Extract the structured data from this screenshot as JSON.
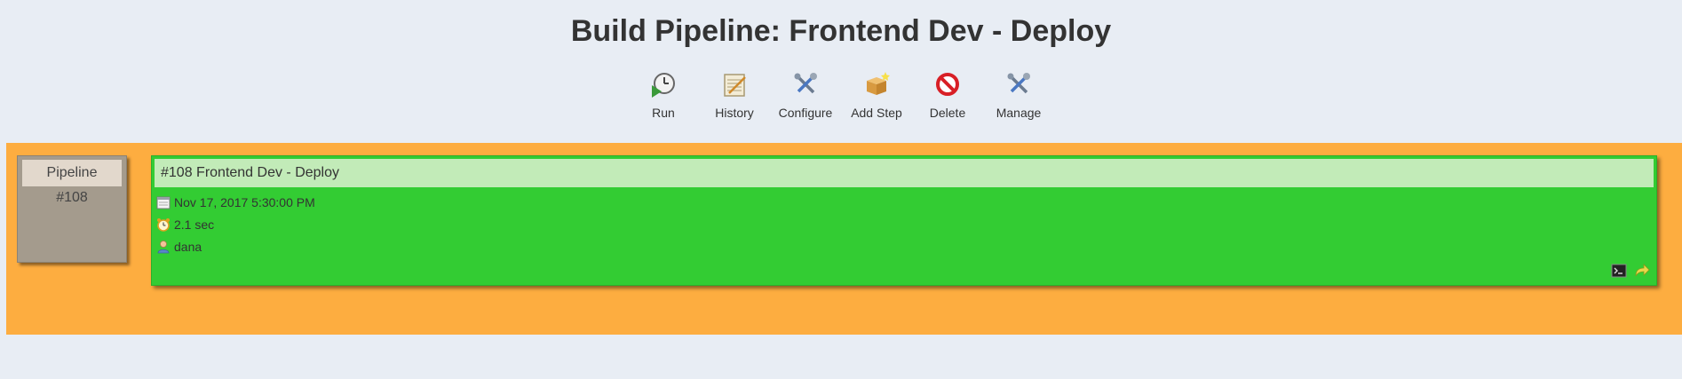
{
  "page": {
    "title": "Build Pipeline: Frontend Dev - Deploy"
  },
  "toolbar": {
    "items": [
      {
        "label": "Run",
        "icon": "run-icon"
      },
      {
        "label": "History",
        "icon": "history-icon"
      },
      {
        "label": "Configure",
        "icon": "configure-icon"
      },
      {
        "label": "Add Step",
        "icon": "add-step-icon"
      },
      {
        "label": "Delete",
        "icon": "delete-icon"
      },
      {
        "label": "Manage",
        "icon": "manage-icon"
      }
    ]
  },
  "pipeline": {
    "label": "Pipeline",
    "number": "#108"
  },
  "build": {
    "title": "#108 Frontend Dev - Deploy",
    "date": "Nov 17, 2017 5:30:00 PM",
    "duration": "2.1 sec",
    "user": "dana",
    "status_color": "#33cc33"
  },
  "colors": {
    "background": "#e8edf4",
    "band": "#fdad40",
    "pipeline_box": "#a49b8d",
    "build_success": "#33cc33",
    "build_header": "#c2ebb8"
  }
}
